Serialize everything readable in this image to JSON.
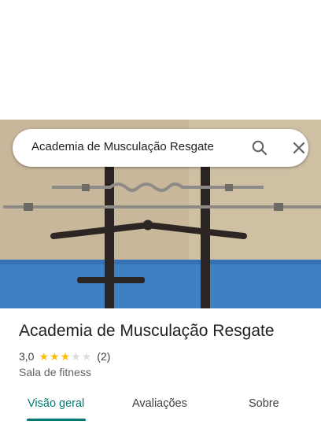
{
  "search": {
    "query": "Academia de Musculação Resgate"
  },
  "place": {
    "name": "Academia de Musculação Resgate",
    "rating": "3,0",
    "stars_filled": 3,
    "stars_total": 5,
    "review_count": "(2)",
    "category": "Sala de fitness"
  },
  "tabs": [
    {
      "label": "Visão geral",
      "active": true
    },
    {
      "label": "Avaliações",
      "active": false
    },
    {
      "label": "Sobre",
      "active": false
    }
  ],
  "colors": {
    "accent": "#017a70",
    "star": "#fbbc04",
    "star_empty": "#dadce0"
  },
  "icons": {
    "search": "search-icon",
    "close": "close-icon"
  }
}
